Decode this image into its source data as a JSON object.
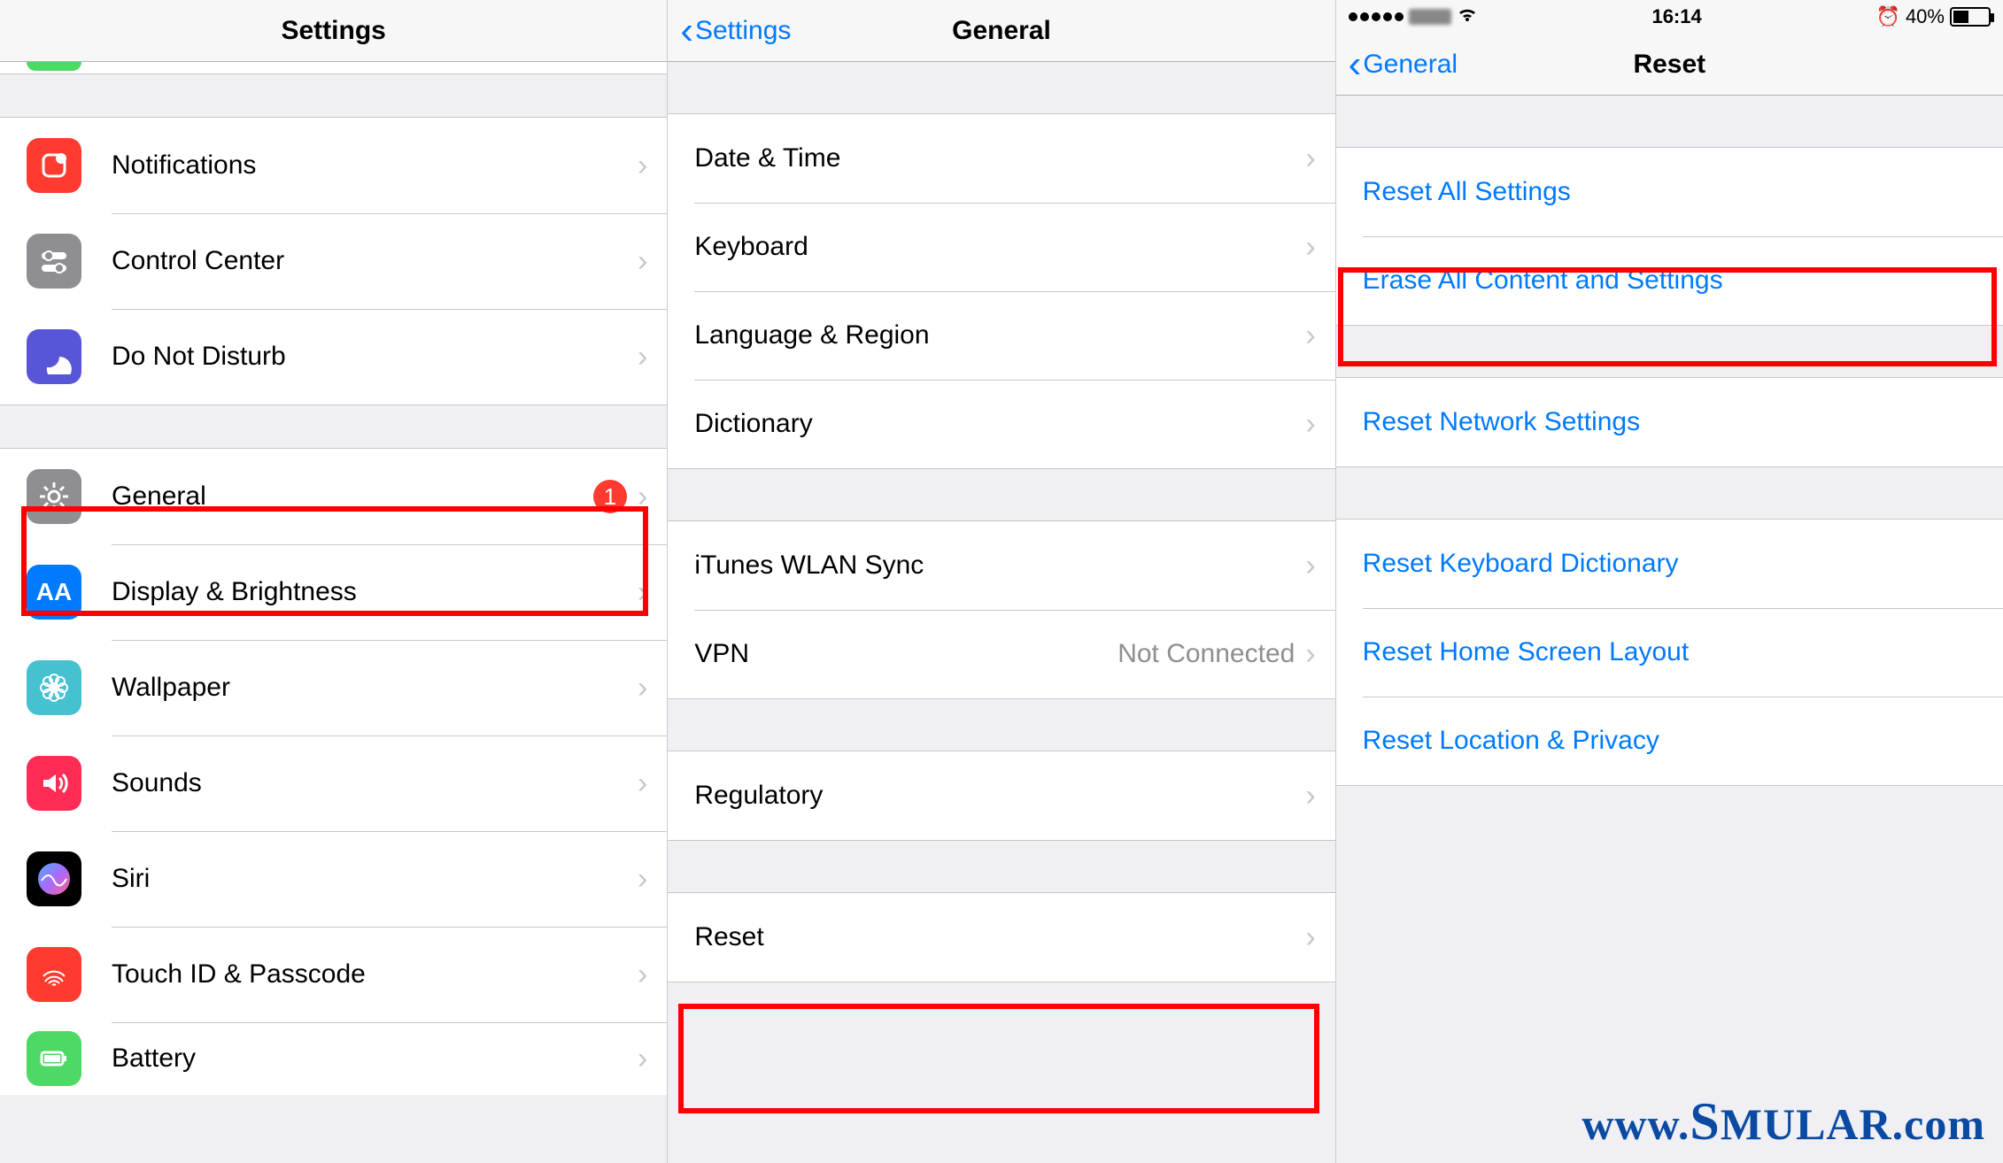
{
  "pane1": {
    "title": "Settings",
    "group2": [
      {
        "label": "Notifications",
        "icon": "notifications",
        "bg": "#ff3b30"
      },
      {
        "label": "Control Center",
        "icon": "controlcenter",
        "bg": "#8e8e93"
      },
      {
        "label": "Do Not Disturb",
        "icon": "dnd",
        "bg": "#5856d6"
      }
    ],
    "group3": [
      {
        "label": "General",
        "icon": "gear",
        "bg": "#8e8e93",
        "badge": "1"
      },
      {
        "label": "Display & Brightness",
        "icon": "aa",
        "bg": "#007aff"
      },
      {
        "label": "Wallpaper",
        "icon": "flower",
        "bg": "#45c1cf"
      },
      {
        "label": "Sounds",
        "icon": "sounds",
        "bg": "#ff2d55"
      },
      {
        "label": "Siri",
        "icon": "siri",
        "bg": "#000"
      },
      {
        "label": "Touch ID & Passcode",
        "icon": "touchid",
        "bg": "#ff3b30"
      },
      {
        "label": "Battery",
        "icon": "battery",
        "bg": "#4cd964"
      }
    ]
  },
  "pane2": {
    "back": "Settings",
    "title": "General",
    "g1": [
      {
        "label": "Date & Time"
      },
      {
        "label": "Keyboard"
      },
      {
        "label": "Language & Region"
      },
      {
        "label": "Dictionary"
      }
    ],
    "g2": [
      {
        "label": "iTunes WLAN Sync"
      },
      {
        "label": "VPN",
        "detail": "Not Connected"
      }
    ],
    "g3": [
      {
        "label": "Regulatory"
      }
    ],
    "g4": [
      {
        "label": "Reset"
      }
    ]
  },
  "pane3": {
    "status": {
      "time": "16:14",
      "pct": "40%"
    },
    "back": "General",
    "title": "Reset",
    "g1": [
      {
        "label": "Reset All Settings"
      },
      {
        "label": "Erase All Content and Settings"
      }
    ],
    "g2": [
      {
        "label": "Reset Network Settings"
      }
    ],
    "g3": [
      {
        "label": "Reset Keyboard Dictionary"
      },
      {
        "label": "Reset Home Screen Layout"
      },
      {
        "label": "Reset Location & Privacy"
      }
    ]
  },
  "watermark": {
    "text1": "www.",
    "text2": "S",
    "text3": "MULAR",
    "text4": ".com"
  }
}
